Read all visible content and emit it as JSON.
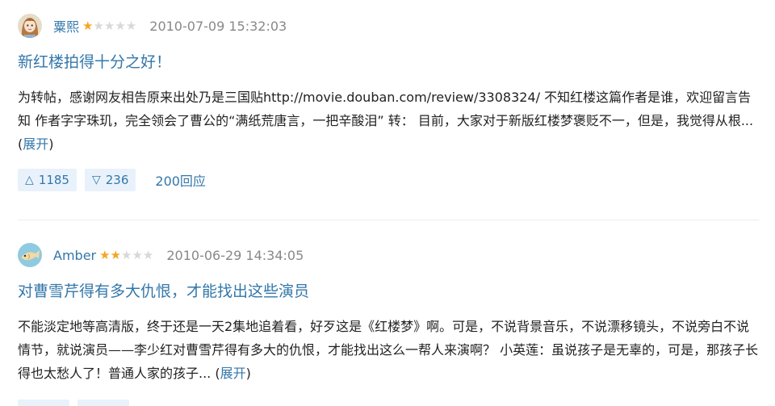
{
  "reviews": [
    {
      "username": "粟熙",
      "rating": 1,
      "stars_display": "★☆☆☆☆",
      "date": "2010-07-09 15:32:03",
      "title": "新红楼拍得十分之好！",
      "body": "为转帖，感谢网友相告原来出处乃是三国贴http://movie.douban.com/review/3308324/ 不知红楼这篇作者是谁，欢迎留言告知 作者字字珠玑，完全领会了曹公的“满纸荒唐言，一把辛酸泪” 转： 目前，大家对于新版红楼梦褒贬不一，但是，我觉得从根... ",
      "expand_label": "展开",
      "useful_count": "1185",
      "useless_count": "236",
      "replies": "200回应"
    },
    {
      "username": "Amber",
      "rating": 2,
      "date": "2010-06-29 14:34:05",
      "title": "对曹雪芹得有多大仇恨，才能找出这些演员",
      "body": "不能淡定地等高清版，终于还是一天2集地追着看，好歹这是《红楼梦》啊。可是，不说背景音乐，不说漂移镜头，不说旁白不说情节，就说演员——李少红对曹雪芹得有多大的仇恨，才能找出这么一帮人来演啊？ 小英莲：虽说孩子是无辜的，可是，那孩子长得也太愁人了！普通人家的孩子... ",
      "expand_label": "展开"
    }
  ],
  "colors": {
    "link": "#3377aa",
    "star_on": "#f4a623",
    "star_off": "#d8d8d8",
    "vote_bg": "#e9f2fb"
  },
  "icons": {
    "up_vote": "up-triangle-icon",
    "down_vote": "down-triangle-icon"
  }
}
